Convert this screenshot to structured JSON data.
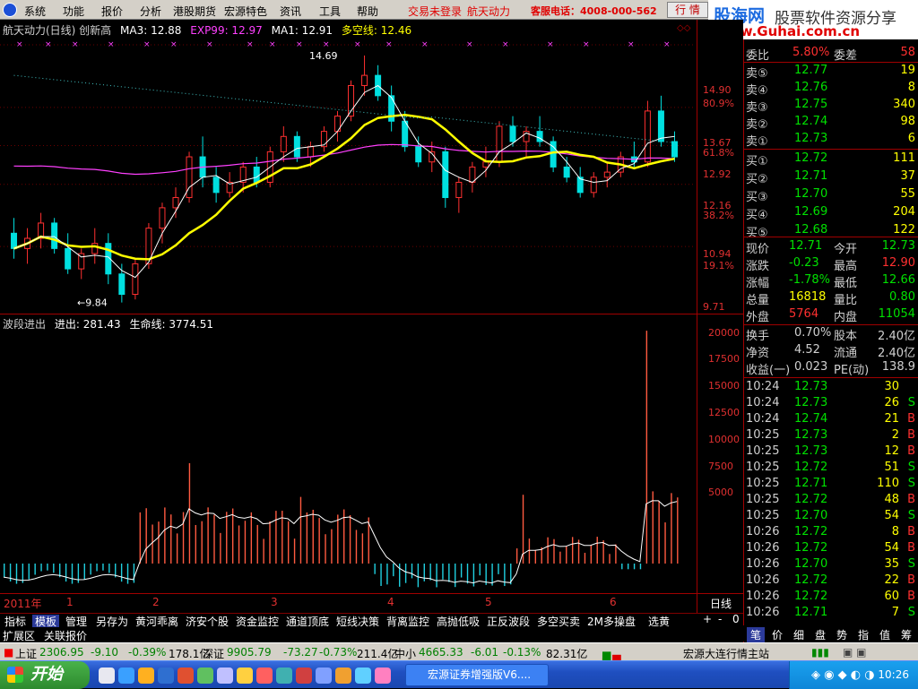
{
  "menubar": {
    "items": [
      "系统",
      "功能",
      "报价",
      "分析",
      "港股期货",
      "宏源特色",
      "资讯",
      "工具",
      "帮助"
    ],
    "login_status": "交易未登录",
    "stock_name": "航天动力",
    "hotline": "客服电话：4008-000-562",
    "quote_button": "行 情",
    "close_glyph": "×",
    "min_glyph": "_"
  },
  "brand": {
    "name": "股海网",
    "slogan": "股票软件资源分享",
    "url": "www.Guhai.com.cn"
  },
  "chart": {
    "title": "航天动力(日线) 创新高",
    "ma3": "MA3: 12.88",
    "exp99": "EXP99: 12.97",
    "ma1": "MA1: 12.91",
    "duokong": "多空线: 12.46",
    "high_label": "14.69",
    "low_label": "←9.84",
    "price_axis": [
      {
        "label": "14.90"
      },
      {
        "label": "80.9%"
      },
      {
        "label": "13.67"
      },
      {
        "label": "61.8%"
      },
      {
        "label": "12.92"
      },
      {
        "label": "12.16"
      },
      {
        "label": "38.2%"
      },
      {
        "label": "10.94"
      },
      {
        "label": "19.1%"
      },
      {
        "label": "9.71"
      }
    ],
    "sub_title": "波段进出",
    "sub_jinchu": "进出: 281.43",
    "sub_shengming": "生命线: 3774.51",
    "vol_axis": [
      "20000",
      "17500",
      "15000",
      "12500",
      "10000",
      "7500",
      "5000"
    ],
    "x_axis": [
      "2011年",
      "1",
      "2",
      "3",
      "4",
      "5",
      "6"
    ],
    "period": "日线",
    "colors": {
      "ma_yellow": "#ffff00",
      "ma_white": "#ffffff",
      "exp_magenta": "#ff40ff",
      "up": "#ff3030",
      "down": "#00e0e0"
    }
  },
  "chart_data": {
    "type": "candlestick",
    "title": "航天动力(日线)",
    "ylim": [
      9.71,
      14.9
    ],
    "candles": [
      [
        11.2,
        11.5,
        10.7,
        10.9
      ],
      [
        10.9,
        11.3,
        10.6,
        11.1
      ],
      [
        11.1,
        11.6,
        10.9,
        11.4
      ],
      [
        11.4,
        11.5,
        10.8,
        10.9
      ],
      [
        10.9,
        11.2,
        10.4,
        10.5
      ],
      [
        10.5,
        10.9,
        10.3,
        10.8
      ],
      [
        10.8,
        11.3,
        10.6,
        11.0
      ],
      [
        11.0,
        11.2,
        10.2,
        10.4
      ],
      [
        10.4,
        10.6,
        9.84,
        10.0
      ],
      [
        10.0,
        10.7,
        9.9,
        10.6
      ],
      [
        10.6,
        11.4,
        10.5,
        11.3
      ],
      [
        11.3,
        11.8,
        11.0,
        11.7
      ],
      [
        11.7,
        12.1,
        11.5,
        11.9
      ],
      [
        11.9,
        12.8,
        11.8,
        12.7
      ],
      [
        12.7,
        13.1,
        12.1,
        12.3
      ],
      [
        12.3,
        12.5,
        11.8,
        12.0
      ],
      [
        12.0,
        12.4,
        11.9,
        12.2
      ],
      [
        12.2,
        12.6,
        12.0,
        12.5
      ],
      [
        12.5,
        12.7,
        12.1,
        12.2
      ],
      [
        12.2,
        12.9,
        12.1,
        12.8
      ],
      [
        12.8,
        13.3,
        12.6,
        13.1
      ],
      [
        13.1,
        13.2,
        12.6,
        12.7
      ],
      [
        12.7,
        13.0,
        12.5,
        12.9
      ],
      [
        12.9,
        13.3,
        12.8,
        13.2
      ],
      [
        13.2,
        13.6,
        13.0,
        13.5
      ],
      [
        13.5,
        14.2,
        13.4,
        14.1
      ],
      [
        14.1,
        14.69,
        13.9,
        14.3
      ],
      [
        14.3,
        14.5,
        13.8,
        13.9
      ],
      [
        13.9,
        14.1,
        13.2,
        13.4
      ],
      [
        13.4,
        13.6,
        12.8,
        12.9
      ],
      [
        12.9,
        13.1,
        12.5,
        12.6
      ],
      [
        12.6,
        13.0,
        12.4,
        12.8
      ],
      [
        12.8,
        12.9,
        11.7,
        11.9
      ],
      [
        11.9,
        12.3,
        11.6,
        12.2
      ],
      [
        12.2,
        12.6,
        12.0,
        12.5
      ],
      [
        12.5,
        12.9,
        12.3,
        12.6
      ],
      [
        12.6,
        13.4,
        12.5,
        13.3
      ],
      [
        13.3,
        13.5,
        12.9,
        13.0
      ],
      [
        13.0,
        13.3,
        12.7,
        13.2
      ],
      [
        13.2,
        13.5,
        12.9,
        13.0
      ],
      [
        13.0,
        13.1,
        12.4,
        12.5
      ],
      [
        12.5,
        12.7,
        12.2,
        12.3
      ],
      [
        12.3,
        12.5,
        11.9,
        12.0
      ],
      [
        12.0,
        12.4,
        11.9,
        12.3
      ],
      [
        12.3,
        12.6,
        12.1,
        12.4
      ],
      [
        12.4,
        12.8,
        12.3,
        12.7
      ],
      [
        12.7,
        13.0,
        12.5,
        12.6
      ],
      [
        12.6,
        13.8,
        12.5,
        13.6
      ],
      [
        13.6,
        13.9,
        12.9,
        13.0
      ],
      [
        13.0,
        13.2,
        12.6,
        12.7
      ]
    ],
    "ma3_last": 12.88,
    "exp99_last": 12.97,
    "ma1_last": 12.91,
    "duokong_last": 12.46
  },
  "quote": {
    "weibi_label": "委比",
    "weibi_val": "5.80%",
    "weicha_label": "委差",
    "weicha_val": "58",
    "sells": [
      {
        "label": "卖⑤",
        "price": "12.77",
        "vol": "19"
      },
      {
        "label": "卖④",
        "price": "12.76",
        "vol": "8"
      },
      {
        "label": "卖③",
        "price": "12.75",
        "vol": "340"
      },
      {
        "label": "卖②",
        "price": "12.74",
        "vol": "98"
      },
      {
        "label": "卖①",
        "price": "12.73",
        "vol": "6"
      }
    ],
    "buys": [
      {
        "label": "买①",
        "price": "12.72",
        "vol": "111"
      },
      {
        "label": "买②",
        "price": "12.71",
        "vol": "37"
      },
      {
        "label": "买③",
        "price": "12.70",
        "vol": "55"
      },
      {
        "label": "买④",
        "price": "12.69",
        "vol": "204"
      },
      {
        "label": "买⑤",
        "price": "12.68",
        "vol": "122"
      }
    ],
    "stats": [
      {
        "l1": "现价",
        "v1": "12.71",
        "l2": "今开",
        "v2": "12.73"
      },
      {
        "l1": "涨跌",
        "v1": "-0.23",
        "l2": "最高",
        "v2": "12.90"
      },
      {
        "l1": "涨幅",
        "v1": "-1.78%",
        "l2": "最低",
        "v2": "12.66"
      },
      {
        "l1": "总量",
        "v1": "16818",
        "l2": "量比",
        "v2": "0.80"
      },
      {
        "l1": "外盘",
        "v1": "5764",
        "l2": "内盘",
        "v2": "11054"
      }
    ],
    "stats2": [
      {
        "l1": "换手",
        "v1": "0.70%",
        "l2": "股本",
        "v2": "2.40亿"
      },
      {
        "l1": "净资",
        "v1": "4.52",
        "l2": "流通",
        "v2": "2.40亿"
      },
      {
        "l1": "收益(一)",
        "v1": "0.023",
        "l2": "PE(动)",
        "v2": "138.9"
      }
    ],
    "ticks": [
      {
        "t": "10:24",
        "p": "12.73",
        "v": "30",
        "s": ""
      },
      {
        "t": "10:24",
        "p": "12.73",
        "v": "26",
        "s": "S"
      },
      {
        "t": "10:24",
        "p": "12.74",
        "v": "21",
        "s": "B"
      },
      {
        "t": "10:25",
        "p": "12.73",
        "v": "2",
        "s": "B"
      },
      {
        "t": "10:25",
        "p": "12.73",
        "v": "12",
        "s": "B"
      },
      {
        "t": "10:25",
        "p": "12.72",
        "v": "51",
        "s": "S"
      },
      {
        "t": "10:25",
        "p": "12.71",
        "v": "110",
        "s": "S"
      },
      {
        "t": "10:25",
        "p": "12.72",
        "v": "48",
        "s": "B"
      },
      {
        "t": "10:25",
        "p": "12.70",
        "v": "54",
        "s": "S"
      },
      {
        "t": "10:26",
        "p": "12.72",
        "v": "8",
        "s": "B"
      },
      {
        "t": "10:26",
        "p": "12.72",
        "v": "54",
        "s": "B"
      },
      {
        "t": "10:26",
        "p": "12.70",
        "v": "35",
        "s": "S"
      },
      {
        "t": "10:26",
        "p": "12.72",
        "v": "22",
        "s": "B"
      },
      {
        "t": "10:26",
        "p": "12.72",
        "v": "60",
        "s": "B"
      },
      {
        "t": "10:26",
        "p": "12.71",
        "v": "7",
        "s": "S"
      }
    ]
  },
  "right_tabs": [
    "笔",
    "价",
    "细",
    "盘",
    "势",
    "指",
    "值",
    "筹"
  ],
  "bottom_tabs": [
    "指标",
    "模板",
    "管理",
    "另存为",
    "黄河乖离",
    "济安个股",
    "资金监控",
    "通道顶底",
    "短线决策",
    "背离监控",
    "高抛低吸",
    "正反波段",
    "多空买卖",
    "2M多操盘",
    "选黄"
  ],
  "bottom_tabs2": [
    "扩展区",
    "关联报价"
  ],
  "zoom": {
    "plus": "+",
    "minus": "-",
    "zero": "0"
  },
  "status": {
    "sh_label": "上证",
    "sh_val": "2306.95",
    "sh_chg": "-9.10",
    "sh_pct": "-0.39%",
    "sh_amt": "178.1亿",
    "sz_label": "深证",
    "sz_val": "9905.79",
    "sz_chg": "-73.27",
    "sz_pct": "-0.73%",
    "sz_amt": "211.4亿",
    "zx_label": "中小",
    "zx_val": "4665.33",
    "zx_chg": "-6.01",
    "zx_pct": "-0.13%",
    "zx_amt": "82.31亿",
    "server": "宏源大连行情主站"
  },
  "taskbar": {
    "start": "开始",
    "app": "宏源证券增强版V6....",
    "clock": "10:26"
  }
}
